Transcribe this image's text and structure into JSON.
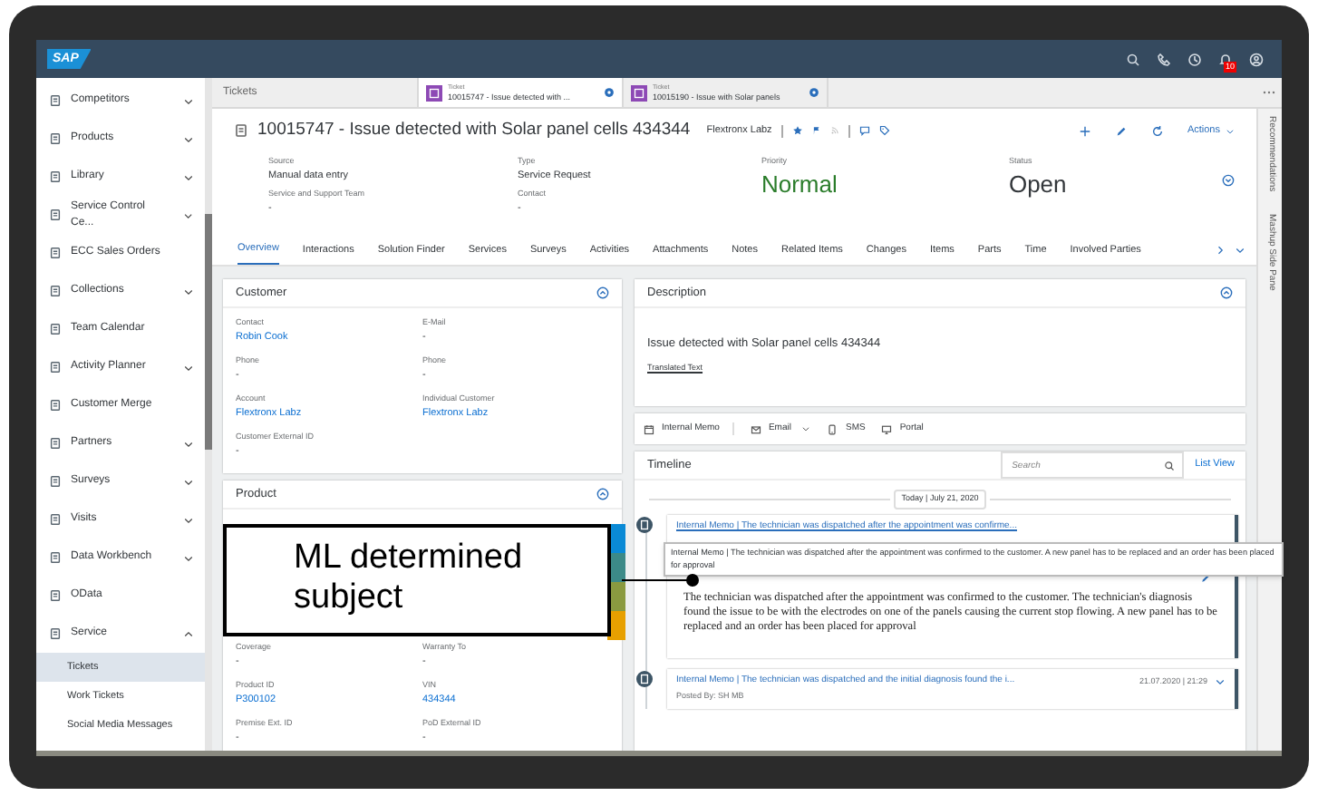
{
  "shell_bar": {
    "logo": "SAP",
    "notification_count": "10"
  },
  "sidebar": {
    "items": [
      {
        "label": "Competitors",
        "expanded": false
      },
      {
        "label": "Products",
        "expanded": false
      },
      {
        "label": "Library",
        "expanded": false
      },
      {
        "label": "Service Control Ce...",
        "expanded": false
      },
      {
        "label": "ECC Sales Orders"
      },
      {
        "label": "Collections",
        "expanded": false
      },
      {
        "label": "Team Calendar"
      },
      {
        "label": "Activity Planner",
        "expanded": false
      },
      {
        "label": "Customer Merge"
      },
      {
        "label": "Partners",
        "expanded": false
      },
      {
        "label": "Surveys",
        "expanded": false
      },
      {
        "label": "Visits",
        "expanded": false
      },
      {
        "label": "Data Workbench",
        "expanded": false
      },
      {
        "label": "OData"
      },
      {
        "label": "Service",
        "expanded": true,
        "children": [
          {
            "label": "Tickets",
            "selected": true
          },
          {
            "label": "Work Tickets",
            "selected": false
          },
          {
            "label": "Social Media Messages",
            "selected": false
          }
        ]
      }
    ]
  },
  "open_tabs": [
    {
      "label": "Tickets",
      "selected": false
    },
    {
      "type": "Ticket",
      "label": "10015747 - Issue detected with ...",
      "selected": true
    },
    {
      "type": "Ticket",
      "label": "10015190 - Issue with Solar panels",
      "selected": false
    }
  ],
  "header": {
    "title": "10015747 - Issue detected with Solar panel cells 434344",
    "account": "Flextronx Labz",
    "actions_label": "Actions",
    "field_columns": [
      [
        {
          "label": "Source",
          "value": "Manual data entry"
        },
        {
          "label": "Service and Support Team",
          "value": "-"
        }
      ],
      [
        {
          "label": "Type",
          "value": "Service Request"
        },
        {
          "label": "Contact",
          "value": "-"
        }
      ],
      [
        {
          "label": "Priority",
          "value": "Normal",
          "kind": "large",
          "color": "#2b7d2b"
        }
      ],
      [
        {
          "label": "Status",
          "value": "Open",
          "kind": "large",
          "color": "#32363a"
        }
      ]
    ]
  },
  "section_tabs": [
    {
      "label": "Overview",
      "selected": true
    },
    {
      "label": "Interactions",
      "selected": false
    },
    {
      "label": "Solution Finder",
      "selected": false
    },
    {
      "label": "Services",
      "selected": false
    },
    {
      "label": "Surveys",
      "selected": false
    },
    {
      "label": "Activities",
      "selected": false
    },
    {
      "label": "Attachments",
      "selected": false
    },
    {
      "label": "Notes",
      "selected": false
    },
    {
      "label": "Related Items",
      "selected": false
    },
    {
      "label": "Changes",
      "selected": false
    },
    {
      "label": "Items",
      "selected": false
    },
    {
      "label": "Parts",
      "selected": false
    },
    {
      "label": "Time",
      "selected": false
    },
    {
      "label": "Involved Parties",
      "selected": false
    }
  ],
  "customer": {
    "title": "Customer",
    "fields": [
      {
        "label": "Contact",
        "value": "Robin Cook",
        "kind": "link"
      },
      {
        "label": "E-Mail",
        "value": "-"
      },
      {
        "label": "Phone",
        "value": "-"
      },
      {
        "label": "Phone",
        "value": "-"
      },
      {
        "label": "Account",
        "value": "Flextronx Labz",
        "kind": "link"
      },
      {
        "label": "Individual Customer",
        "value": "Flextronx Labz",
        "kind": "link"
      },
      {
        "label": "Customer External ID",
        "value": "-"
      }
    ]
  },
  "product": {
    "title": "Product",
    "fields": [
      {
        "label": "Coverage",
        "value": "-"
      },
      {
        "label": "Warranty To",
        "value": "-"
      },
      {
        "label": "Product ID",
        "value": "P300102",
        "kind": "link"
      },
      {
        "label": "VIN",
        "value": "434344",
        "kind": "link"
      },
      {
        "label": "Premise Ext. ID",
        "value": "-"
      },
      {
        "label": "PoD External ID",
        "value": "-"
      }
    ]
  },
  "description": {
    "title": "Description",
    "text": "Issue detected with Solar panel cells 434344",
    "link": "Translated Text"
  },
  "compose_actions": [
    {
      "label": "Internal Memo",
      "kind": "memo"
    },
    {
      "label": "Email",
      "kind": "email"
    },
    {
      "label": "SMS",
      "kind": "sms"
    },
    {
      "label": "Portal",
      "kind": "portal"
    }
  ],
  "timeline": {
    "title": "Timeline",
    "search_placeholder": "Search",
    "view_link": "List View",
    "date": "Today | July 21, 2020",
    "entries": [
      {
        "title": "Internal Memo | The technician was dispatched after the appointment was confirme...",
        "expanded": true,
        "body": "The technician was dispatched after the appointment was confirmed to the customer. The technician's diagnosis found the issue to be with the electrodes on one of the panels causing the current stop flowing. A new panel has to be replaced and an order has been placed for approval"
      },
      {
        "title": "Internal Memo | The technician was dispatched and the initial diagnosis found the i...",
        "timestamp": "21.07.2020 | 21:29",
        "posted_by": "Posted By: SH MB",
        "expanded": false
      }
    ]
  },
  "tooltip": "Internal Memo | The technician was dispatched after the appointment was confirmed to the customer. A new panel has to be replaced and an order has been placed for approval",
  "side_panel": [
    "Recommendations",
    "Mashup Side Pane"
  ],
  "callout": "ML determined subject"
}
